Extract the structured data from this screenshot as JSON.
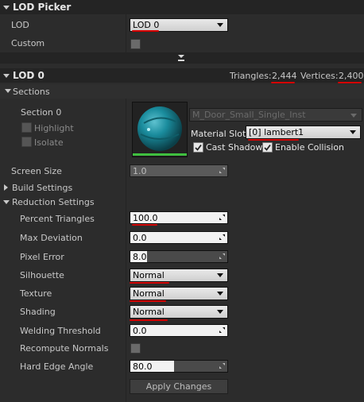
{
  "lod_picker": {
    "title": "LOD Picker",
    "lod_label": "LOD",
    "lod_value": "LOD 0",
    "custom_label": "Custom"
  },
  "lod0": {
    "title": "LOD 0",
    "triangles_label": "Triangles:",
    "triangles_value": "2,444",
    "vertices_label": "Vertices:",
    "vertices_value": "2,400"
  },
  "sections": {
    "title": "Sections",
    "section_label": "Section 0",
    "highlight_label": "Highlight",
    "isolate_label": "Isolate",
    "material_name": "M_Door_Small_Single_Inst",
    "material_slot_label": "Material Slot",
    "material_slot_value": "[0] lambert1",
    "cast_shadow_label": "Cast Shadow",
    "enable_collision_label": "Enable Collision"
  },
  "screen_size": {
    "label": "Screen Size",
    "value": "1.0"
  },
  "build_settings": {
    "label": "Build Settings"
  },
  "reduction": {
    "title": "Reduction Settings",
    "percent_triangles_label": "Percent Triangles",
    "percent_triangles_value": "100.0",
    "max_deviation_label": "Max Deviation",
    "max_deviation_value": "0.0",
    "pixel_error_label": "Pixel Error",
    "pixel_error_value": "8.0",
    "silhouette_label": "Silhouette",
    "silhouette_value": "Normal",
    "texture_label": "Texture",
    "texture_value": "Normal",
    "shading_label": "Shading",
    "shading_value": "Normal",
    "welding_label": "Welding Threshold",
    "welding_value": "0.0",
    "recompute_label": "Recompute Normals",
    "hard_edge_label": "Hard Edge Angle",
    "hard_edge_value": "80.0",
    "apply_label": "Apply Changes"
  },
  "colors": {
    "annotation_red": "#d40000",
    "accent_green": "#3fbf3f"
  }
}
